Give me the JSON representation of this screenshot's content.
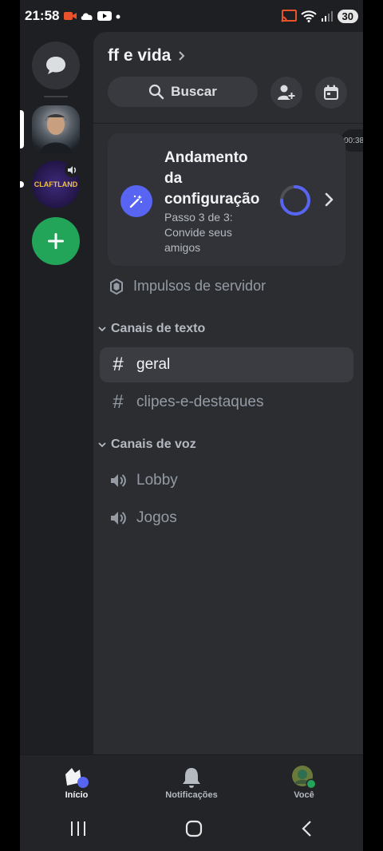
{
  "status": {
    "time": "21:58",
    "battery": "30"
  },
  "rail": {
    "server2_label": "CLAFTLAND"
  },
  "server": {
    "name": "ff e vida"
  },
  "search": {
    "label": "Buscar"
  },
  "time_bubble": "00:38",
  "setup": {
    "title": "Andamento da configuração",
    "subtitle": "Passo 3 de 3: Convide seus amigos",
    "progress_fraction": 0.75
  },
  "boosts": {
    "label": "Impulsos de servidor"
  },
  "text_category": {
    "label": "Canais de texto"
  },
  "text_channels": [
    {
      "name": "geral",
      "selected": true
    },
    {
      "name": "clipes-e-destaques",
      "selected": false
    }
  ],
  "voice_category": {
    "label": "Canais de voz"
  },
  "voice_channels": [
    {
      "name": "Lobby"
    },
    {
      "name": "Jogos"
    }
  ],
  "bottom_nav": [
    {
      "label": "Início",
      "icon": "home-icon",
      "active": true
    },
    {
      "label": "Notificações",
      "icon": "bell-icon",
      "active": false
    },
    {
      "label": "Você",
      "icon": "avatar-icon",
      "active": false
    }
  ],
  "colors": {
    "accent": "#5865f2",
    "online": "#23a559",
    "background": "#2b2d31"
  }
}
